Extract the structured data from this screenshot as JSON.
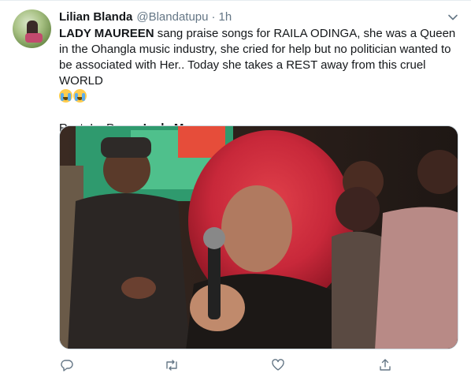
{
  "tweet": {
    "author": {
      "name": "Lilian Blanda",
      "handle": "@Blandatupu",
      "separator": "·",
      "time": "1h"
    },
    "text": {
      "bold_lead": "LADY MAUREEN",
      "sentence_1": " sang praise songs for RAILA ODINGA, she was a Queen in the Ohangla music industry, she cried for help but no politician wanted to be associated with Her.. Today she takes a REST away from this cruel WORLD",
      "emojis": [
        "loudly-crying-face",
        "loudly-crying-face"
      ],
      "line2_prefix": "Rest. In. Peace ",
      "line2_bold": "Lady Maureen"
    },
    "actions": [
      "reply-icon",
      "retweet-icon",
      "like-icon",
      "share-icon"
    ],
    "colors": {
      "text": "#14171a",
      "muted": "#657786",
      "border": "#e6ecf0"
    }
  }
}
